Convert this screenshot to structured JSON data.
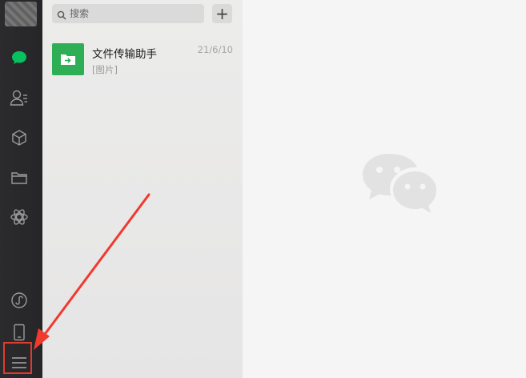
{
  "sidebar": {
    "items": [
      {
        "name": "chat-icon",
        "active": true
      },
      {
        "name": "contacts-icon"
      },
      {
        "name": "favorites-icon"
      },
      {
        "name": "files-icon"
      },
      {
        "name": "moments-icon"
      },
      {
        "name": "mini-program-icon"
      },
      {
        "name": "phone-icon"
      },
      {
        "name": "menu-icon"
      }
    ],
    "active_color": "#07c160",
    "highlight_color": "#e23b2e"
  },
  "search": {
    "placeholder": "搜索"
  },
  "toolbar": {
    "add_label": "+"
  },
  "chats": [
    {
      "name": "文件传输助手",
      "preview": "[图片]",
      "time": "21/6/10",
      "icon": "file-transfer-icon",
      "icon_color": "#2eaf55"
    }
  ],
  "main": {
    "logo": "wechat-logo-icon"
  },
  "annotation": {
    "arrow_color": "#f03a2e"
  }
}
